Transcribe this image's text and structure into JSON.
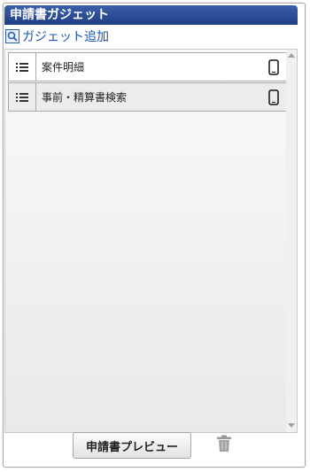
{
  "panel": {
    "title": "申請書ガジェット"
  },
  "add_gadget": {
    "label": "ガジェット追加",
    "icon": "search-icon"
  },
  "gadgets": [
    {
      "label": "案件明細",
      "handle_icon": "list-icon",
      "device_icon": "smartphone-icon"
    },
    {
      "label": "事前・精算書検索",
      "handle_icon": "list-icon",
      "device_icon": "smartphone-icon"
    }
  ],
  "footer": {
    "preview_label": "申請書プレビュー",
    "trash_icon": "trash-icon"
  },
  "colors": {
    "title_bar": "#1f3f86",
    "link": "#1a55b5"
  }
}
